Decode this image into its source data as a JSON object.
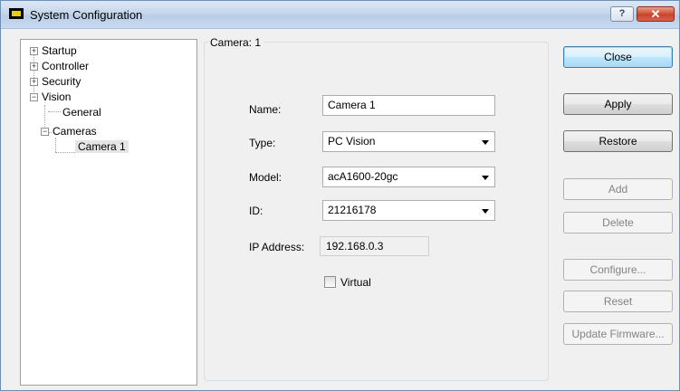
{
  "window": {
    "title": "System Configuration",
    "help_label": "?",
    "close_label": "✕"
  },
  "tree": {
    "items": [
      {
        "label": "Startup",
        "expander": "+"
      },
      {
        "label": "Controller",
        "expander": "+"
      },
      {
        "label": "Security",
        "expander": "+"
      },
      {
        "label": "Vision",
        "expander": "−"
      },
      {
        "label": "General"
      },
      {
        "label": "Cameras",
        "expander": "−"
      },
      {
        "label": "Camera 1",
        "selected": true
      }
    ]
  },
  "panel": {
    "group_title": "Camera: 1",
    "name_label": "Name:",
    "name_value": "Camera 1",
    "type_label": "Type:",
    "type_value": "PC Vision",
    "model_label": "Model:",
    "model_value": "acA1600-20gc",
    "id_label": "ID:",
    "id_value": "21216178",
    "ip_label": "IP Address:",
    "ip_value": "192.168.0.3",
    "virtual_label": "Virtual",
    "virtual_checked": false
  },
  "buttons": {
    "close": "Close",
    "apply": "Apply",
    "restore": "Restore",
    "add": "Add",
    "delete": "Delete",
    "configure": "Configure...",
    "reset": "Reset",
    "update_firmware": "Update Firmware..."
  },
  "colors": {
    "title_bar": "#c6d7ec",
    "close_button": "#c8462a",
    "default_button_border": "#3c7fb1"
  }
}
